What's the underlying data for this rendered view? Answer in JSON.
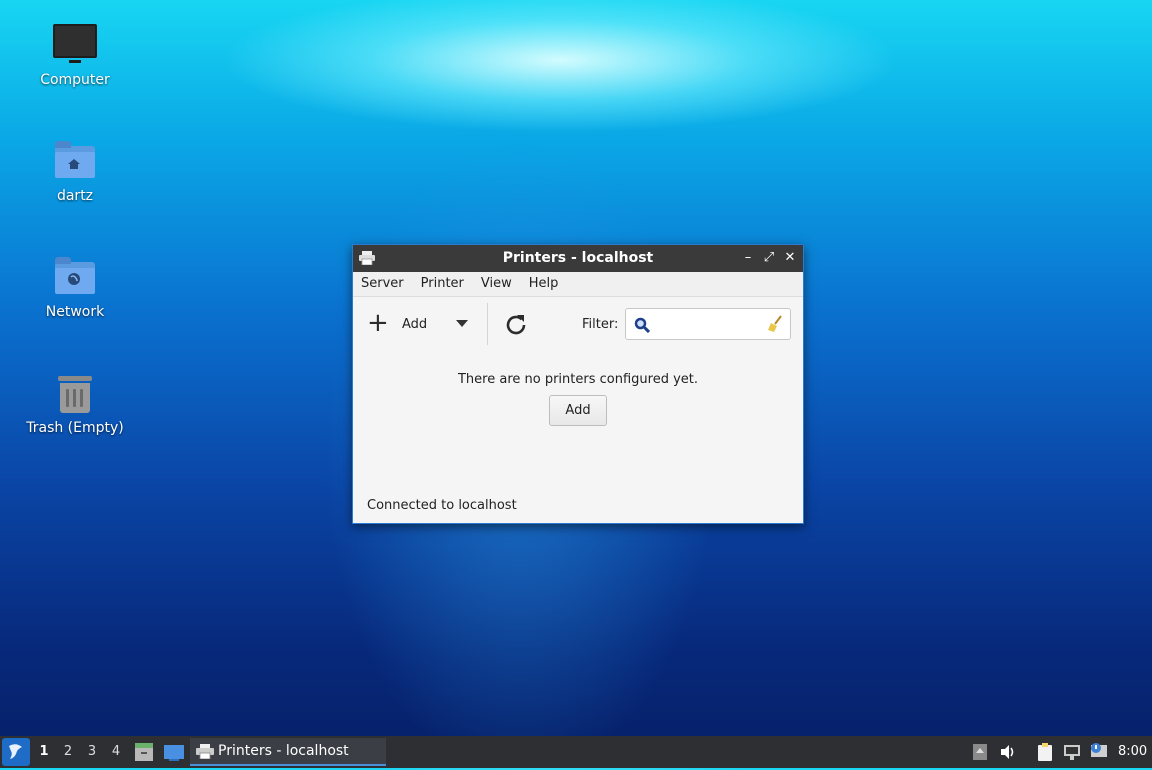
{
  "desktop": {
    "icons": [
      {
        "label": "Computer",
        "icon": "computer-icon"
      },
      {
        "label": "dartz",
        "icon": "home-folder-icon"
      },
      {
        "label": "Network",
        "icon": "network-folder-icon"
      },
      {
        "label": "Trash (Empty)",
        "icon": "trash-icon"
      }
    ]
  },
  "window": {
    "title": "Printers - localhost",
    "controls": {
      "minimize": "–",
      "maximize": "⤢",
      "close": "✕"
    },
    "menu": [
      "Server",
      "Printer",
      "View",
      "Help"
    ],
    "toolbar": {
      "add_label": "Add",
      "filter_label": "Filter:",
      "filter_value": ""
    },
    "empty_message": "There are no printers configured yet.",
    "add_button": "Add",
    "status": "Connected to localhost"
  },
  "taskbar": {
    "workspaces": [
      "1",
      "2",
      "3",
      "4"
    ],
    "active_workspace": "1",
    "task_label": "Printers - localhost",
    "clock": "8:00"
  },
  "colors": {
    "window_border": "#2b7bd0",
    "titlebar": "#3a3a3a",
    "taskbar": "#2d2f33",
    "accent": "#4a90d9"
  }
}
